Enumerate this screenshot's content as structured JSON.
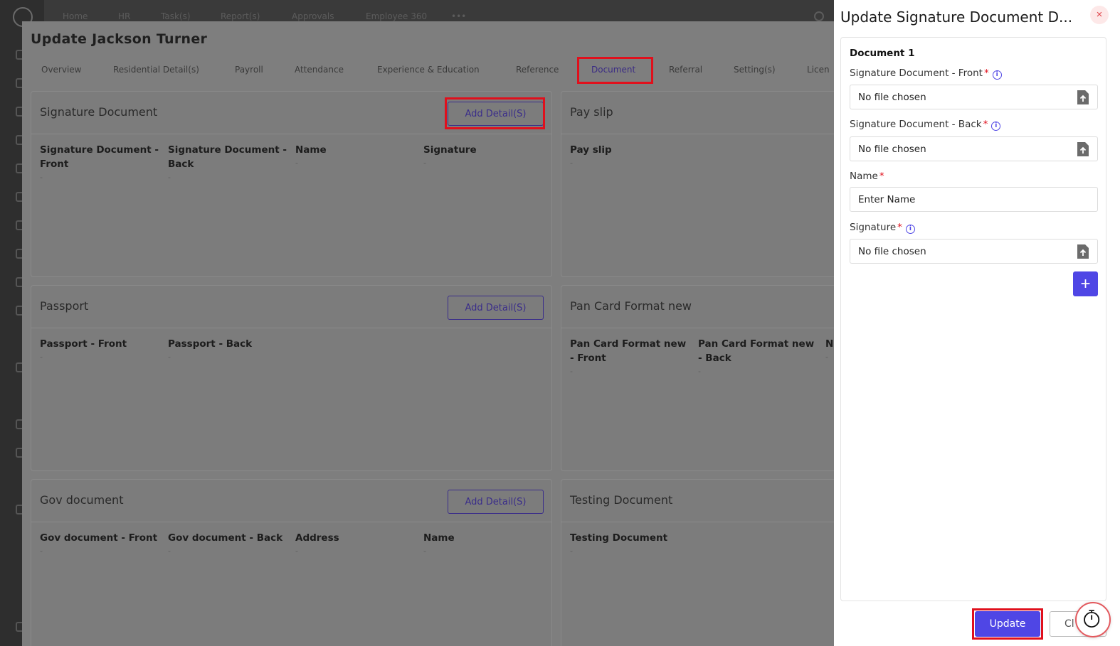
{
  "app": {
    "nav": [
      "Home",
      "HR",
      "Task(s)",
      "Report(s)",
      "Approvals",
      "Employee 360",
      "•••"
    ]
  },
  "modal": {
    "title": "Update Jackson Turner",
    "tabs": [
      "Overview",
      "Residential Detail(s)",
      "Payroll",
      "Attendance",
      "Experience & Education",
      "Reference",
      "Document",
      "Referral",
      "Setting(s)",
      "Licen"
    ],
    "active_tab": "Document",
    "cards": {
      "signature": {
        "title": "Signature Document",
        "button": "Add Detail(S)",
        "columns": [
          {
            "label": "Signature Document - Front",
            "value": "-"
          },
          {
            "label": "Signature Document - Back",
            "value": "-"
          },
          {
            "label": "Name",
            "value": "-"
          },
          {
            "label": "Signature",
            "value": "-"
          }
        ]
      },
      "payslip": {
        "title": "Pay slip",
        "columns": [
          {
            "label": "Pay slip",
            "value": "-"
          }
        ]
      },
      "passport": {
        "title": "Passport",
        "button": "Add Detail(S)",
        "columns": [
          {
            "label": "Passport - Front",
            "value": "-"
          },
          {
            "label": "Passport - Back",
            "value": "-"
          }
        ]
      },
      "pancard": {
        "title": "Pan Card Format new",
        "columns": [
          {
            "label": "Pan Card Format new - Front",
            "value": "-"
          },
          {
            "label": "Pan Card Format new - Back",
            "value": "-"
          },
          {
            "label": "N",
            "value": "-"
          }
        ]
      },
      "gov": {
        "title": "Gov document",
        "button": "Add Detail(S)",
        "columns": [
          {
            "label": "Gov document - Front",
            "value": "-"
          },
          {
            "label": "Gov document - Back",
            "value": "-"
          },
          {
            "label": "Address",
            "value": "-"
          },
          {
            "label": "Name",
            "value": "-"
          }
        ]
      },
      "testing": {
        "title": "Testing Document",
        "columns": [
          {
            "label": "Testing Document",
            "value": "-"
          }
        ]
      }
    }
  },
  "drawer": {
    "title": "Update Signature Document D...",
    "close_symbol": "×",
    "document_label": "Document 1",
    "fields": {
      "front": {
        "label": "Signature Document - Front",
        "required": "*",
        "value": "No file chosen"
      },
      "back": {
        "label": "Signature Document - Back",
        "required": "*",
        "value": "No file chosen"
      },
      "name": {
        "label": "Name",
        "required": "*",
        "placeholder": "Enter Name"
      },
      "signature": {
        "label": "Signature",
        "required": "*",
        "value": "No file chosen"
      }
    },
    "info_symbol": "i",
    "add_symbol": "+",
    "update_label": "Update",
    "clear_label": "Cl"
  },
  "colors": {
    "accent": "#4f46e5",
    "highlight": "#e0101c",
    "required": "#e0101c"
  }
}
